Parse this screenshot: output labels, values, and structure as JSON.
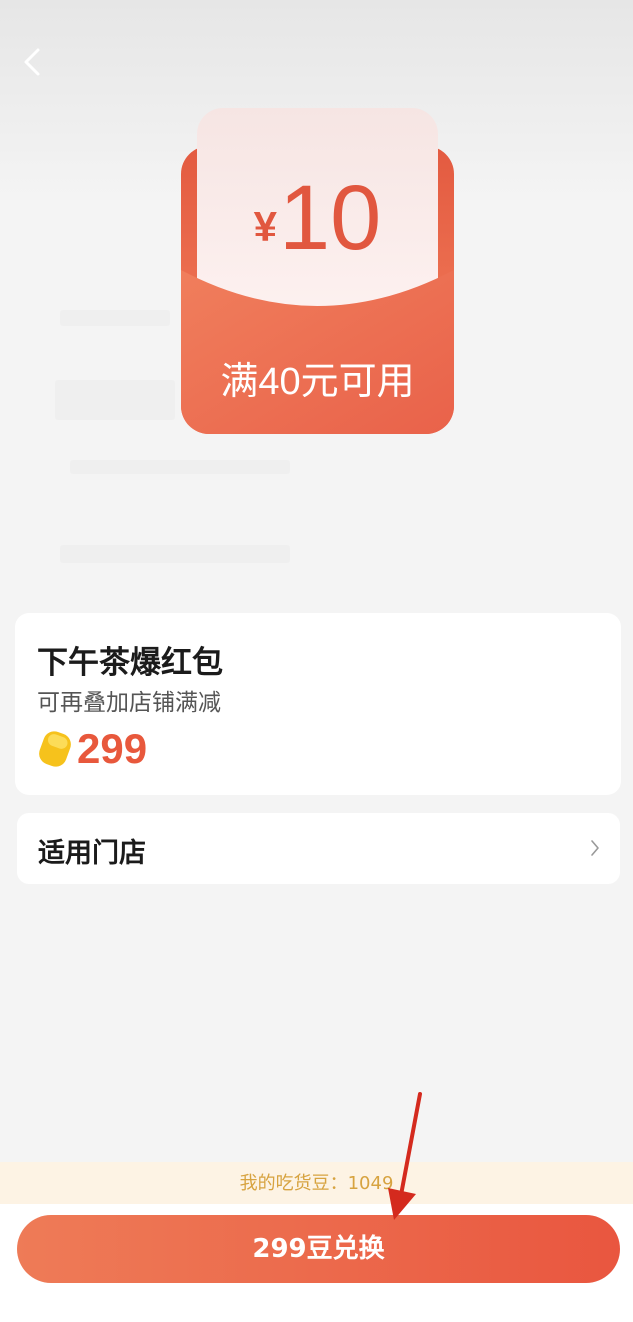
{
  "nav": {
    "back_icon": "chevron-left-icon"
  },
  "coupon": {
    "currency": "¥",
    "amount": "10",
    "condition": "满40元可用"
  },
  "product": {
    "title": "下午茶爆红包",
    "subtitle": "可再叠加店铺满减",
    "price_icon": "bean-icon",
    "price": "299"
  },
  "stores_row": {
    "label": "适用门店",
    "chevron_icon": "chevron-right-icon"
  },
  "footer": {
    "bean_balance_text": "我的吃货豆：1049",
    "redeem_button": "299豆兑换"
  },
  "colors": {
    "accent": "#e8583c",
    "bean_bar_bg": "#fdf3e4",
    "bean_bar_text": "#d7a340"
  }
}
